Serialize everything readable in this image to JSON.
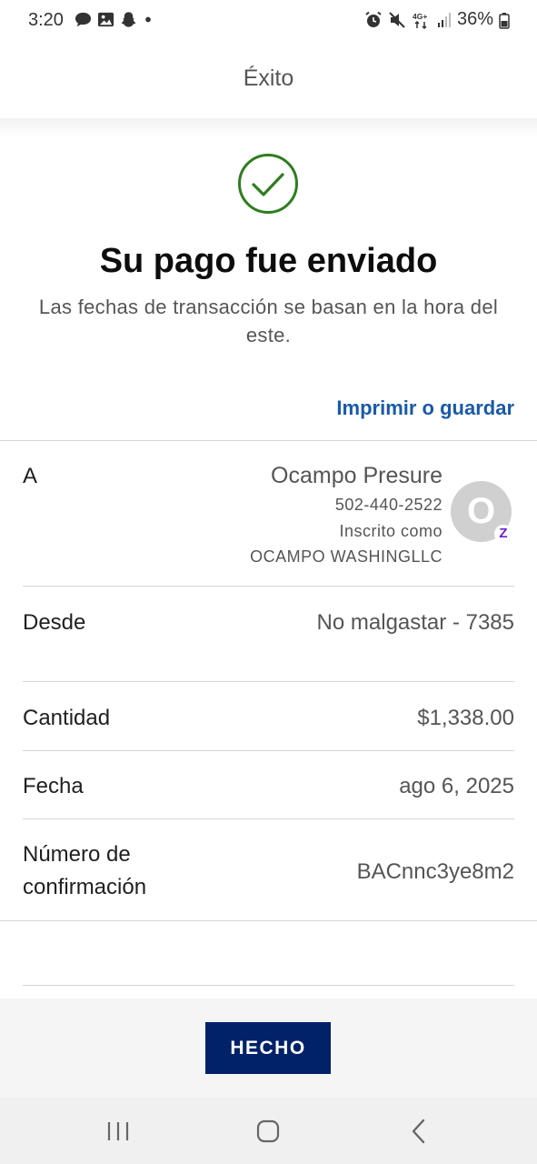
{
  "status_bar": {
    "time": "3:20",
    "left_icons": [
      "chat-bubble-icon",
      "image-icon",
      "snapchat-icon",
      "dot-icon"
    ],
    "right_icons": [
      "alarm-icon",
      "mute-icon",
      "network-4g-icon",
      "signal-icon",
      "battery-icon"
    ],
    "network_label": "4G+",
    "battery_percent": "36%"
  },
  "header": {
    "title": "Éxito"
  },
  "success": {
    "icon": "checkmark-circle-icon",
    "icon_color": "#2e7d1e",
    "title": "Su pago fue enviado",
    "note": "Las fechas de transacción se basan en la hora del este.",
    "print_link": "Imprimir o guardar"
  },
  "details": {
    "recipient": {
      "label": "A",
      "name": "Ocampo Presure",
      "phone": "502-440-2522",
      "enrolled_as": "Inscrito como",
      "enrolled_name": "OCAMPO WASHINGLLC",
      "avatar_letter": "O",
      "badge": "Z"
    },
    "from": {
      "label": "Desde",
      "value": "No malgastar - 7385"
    },
    "amount": {
      "label": "Cantidad",
      "value": "$1,338.00"
    },
    "date": {
      "label": "Fecha",
      "value": "ago 6, 2025"
    },
    "confirmation": {
      "label_line1": "Número de",
      "label_line2": "confirmación",
      "value": "BACnnc3ye8m2"
    }
  },
  "footer": {
    "done_label": "HECHO",
    "done_color": "#012169"
  },
  "nav": {
    "icons": [
      "recent-apps-icon",
      "home-icon",
      "back-icon"
    ]
  }
}
